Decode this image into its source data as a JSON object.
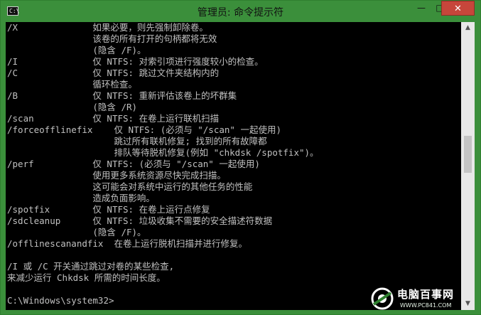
{
  "window": {
    "title": "管理员: 命令提示符",
    "controls": {
      "minimize": "—",
      "maximize": "□",
      "close": "✕"
    }
  },
  "console": {
    "lines": [
      "/X              如果必要，则先强制卸除卷。",
      "                该卷的所有打开的句柄都将无效",
      "                (隐含 /F)。",
      "/I              仅 NTFS: 对索引项进行强度较小的检查。",
      "/C              仅 NTFS: 跳过文件夹结构内的",
      "                循环检查。",
      "/B              仅 NTFS: 重新评估该卷上的坏群集",
      "                (隐含 /R)",
      "/scan           仅 NTFS: 在卷上运行联机扫描",
      "/forceofflinefix    仅 NTFS: (必须与 \"/scan\" 一起使用)",
      "                    跳过所有联机修复; 找到的所有故障都",
      "                    排队等待脱机修复(例如 \"chkdsk /spotfix\")。",
      "/perf           仅 NTFS: (必须与 \"/scan\" 一起使用)",
      "                使用更多系统资源尽快完成扫描。",
      "                这可能会对系统中运行的其他任务的性能",
      "                造成负面影响。",
      "/spotfix        仅 NTFS: 在卷上运行点修复",
      "/sdcleanup      仅 NTFS: 垃圾收集不需要的安全描述符数据",
      "                (隐含 /F)。",
      "/offlinescanandfix  在卷上运行脱机扫描并进行修复。",
      "",
      "/I 或 /C 开关通过跳过对卷的某些检查,",
      "来减少运行 Chkdsk 所需的时间长度。",
      "",
      "C:\\Windows\\system32>"
    ]
  },
  "watermark": {
    "brand": "电脑百事网",
    "url": "WWW.PC841.COM"
  },
  "colors": {
    "frame": "#3b8f3b",
    "console_bg": "#000000",
    "console_text": "#c0c0c0",
    "close_button": "#c7463b"
  }
}
